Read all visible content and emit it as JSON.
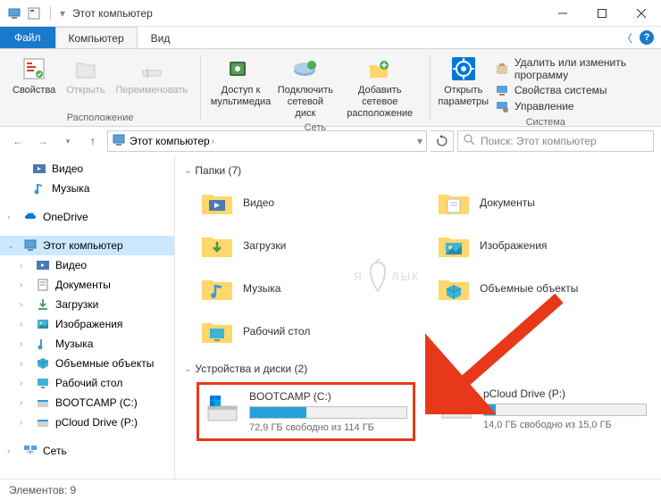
{
  "title": "Этот компьютер",
  "tabs": {
    "file": "Файл",
    "computer": "Компьютер",
    "view": "Вид"
  },
  "ribbon": {
    "group_location": "Расположение",
    "group_network": "Сеть",
    "group_system": "Система",
    "properties": "Свойства",
    "open": "Открыть",
    "rename": "Переименовать",
    "media_access": "Доступ к\nмультимедиа",
    "map_drive": "Подключить\nсетевой диск",
    "add_net": "Добавить сетевое\nрасположение",
    "open_settings": "Открыть\nпараметры",
    "uninstall": "Удалить или изменить программу",
    "sys_props": "Свойства системы",
    "manage": "Управление"
  },
  "nav": {
    "breadcrumb": "Этот компьютер",
    "search_placeholder": "Поиск: Этот компьютер"
  },
  "sidebar": {
    "videos": "Видео",
    "music": "Музыка",
    "onedrive": "OneDrive",
    "this_pc": "Этот компьютер",
    "sub": {
      "videos": "Видео",
      "documents": "Документы",
      "downloads": "Загрузки",
      "pictures": "Изображения",
      "music": "Музыка",
      "objects3d": "Объемные объекты",
      "desktop": "Рабочий стол",
      "bootcamp": "BOOTCAMP (C:)",
      "pcloud": "pCloud Drive (P:)"
    },
    "network": "Сеть"
  },
  "content": {
    "folders_header": "Папки (7)",
    "drives_header": "Устройства и диски (2)",
    "folders": {
      "videos": "Видео",
      "documents": "Документы",
      "downloads": "Загрузки",
      "pictures": "Изображения",
      "music": "Музыка",
      "objects3d": "Объемные объекты",
      "desktop": "Рабочий стол"
    },
    "drives": {
      "c": {
        "name": "BOOTCAMP (C:)",
        "free": "72,9 ГБ свободно из 114 ГБ",
        "fill_pct": 36
      },
      "p": {
        "name": "pCloud Drive (P:)",
        "free": "14,0 ГБ свободно из 15,0 ГБ",
        "fill_pct": 7
      }
    }
  },
  "status": "Элементов: 9",
  "watermark": "Я  ЛЫК"
}
